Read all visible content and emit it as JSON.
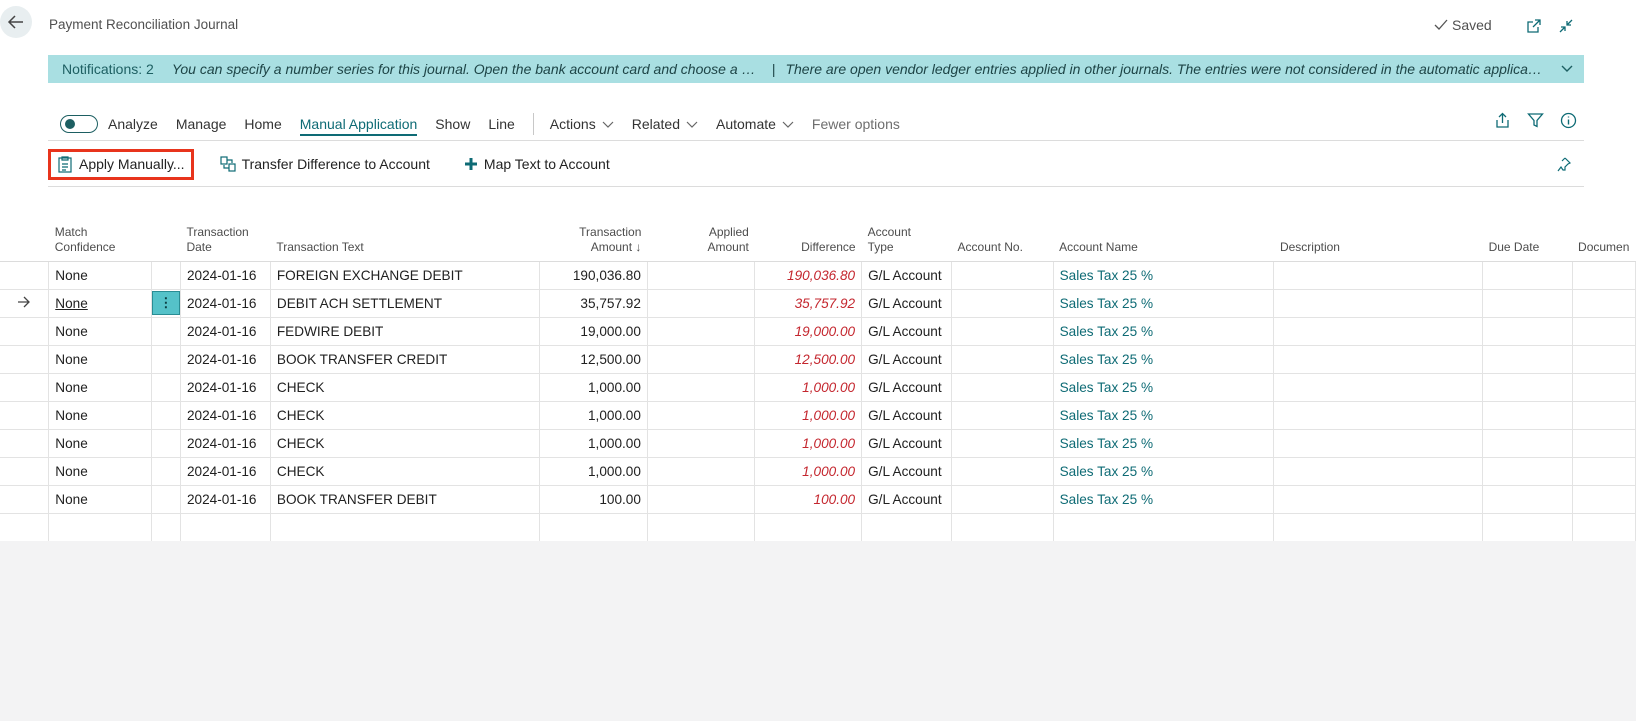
{
  "header": {
    "title": "Payment Reconciliation Journal",
    "saved": "Saved"
  },
  "notifications": {
    "count": "Notifications: 2",
    "msg1": "You can specify a number series for this journal. Open the bank account card and choose a nu...",
    "separator": "|",
    "msg2": "There are open vendor ledger entries applied in other journals. The entries were not considered in the automatic applicati..."
  },
  "menu": {
    "analyze": "Analyze",
    "manage": "Manage",
    "home": "Home",
    "manual_application": "Manual Application",
    "show": "Show",
    "line": "Line",
    "actions": "Actions",
    "related": "Related",
    "automate": "Automate",
    "fewer_options": "Fewer options"
  },
  "actions": {
    "apply_manually": "Apply Manually...",
    "transfer_difference": "Transfer Difference to Account",
    "map_text": "Map Text to Account"
  },
  "columns": {
    "match_confidence": [
      "Match",
      "Confidence"
    ],
    "transaction_date": [
      "Transaction",
      "Date"
    ],
    "transaction_text": "Transaction Text",
    "transaction_amount": [
      "Transaction",
      "Amount ↓"
    ],
    "applied_amount": [
      "Applied",
      "Amount"
    ],
    "difference": "Difference",
    "account_type": [
      "Account",
      "Type"
    ],
    "account_no": "Account No.",
    "account_name": "Account Name",
    "description": "Description",
    "due_date": "Due Date",
    "document": "Documen"
  },
  "rows": [
    {
      "match": "None",
      "date": "2024-01-16",
      "text": "FOREIGN EXCHANGE DEBIT",
      "amount": "190,036.80",
      "applied": "",
      "diff": "190,036.80",
      "type": "G/L Account",
      "no": "",
      "name": "Sales Tax 25 %"
    },
    {
      "match": "None",
      "date": "2024-01-16",
      "text": "DEBIT ACH SETTLEMENT",
      "amount": "35,757.92",
      "applied": "",
      "diff": "35,757.92",
      "type": "G/L Account",
      "no": "",
      "name": "Sales Tax 25 %"
    },
    {
      "match": "None",
      "date": "2024-01-16",
      "text": "FEDWIRE DEBIT",
      "amount": "19,000.00",
      "applied": "",
      "diff": "19,000.00",
      "type": "G/L Account",
      "no": "",
      "name": "Sales Tax 25 %"
    },
    {
      "match": "None",
      "date": "2024-01-16",
      "text": "BOOK TRANSFER CREDIT",
      "amount": "12,500.00",
      "applied": "",
      "diff": "12,500.00",
      "type": "G/L Account",
      "no": "",
      "name": "Sales Tax 25 %"
    },
    {
      "match": "None",
      "date": "2024-01-16",
      "text": "CHECK",
      "amount": "1,000.00",
      "applied": "",
      "diff": "1,000.00",
      "type": "G/L Account",
      "no": "",
      "name": "Sales Tax 25 %"
    },
    {
      "match": "None",
      "date": "2024-01-16",
      "text": "CHECK",
      "amount": "1,000.00",
      "applied": "",
      "diff": "1,000.00",
      "type": "G/L Account",
      "no": "",
      "name": "Sales Tax 25 %"
    },
    {
      "match": "None",
      "date": "2024-01-16",
      "text": "CHECK",
      "amount": "1,000.00",
      "applied": "",
      "diff": "1,000.00",
      "type": "G/L Account",
      "no": "",
      "name": "Sales Tax 25 %"
    },
    {
      "match": "None",
      "date": "2024-01-16",
      "text": "CHECK",
      "amount": "1,000.00",
      "applied": "",
      "diff": "1,000.00",
      "type": "G/L Account",
      "no": "",
      "name": "Sales Tax 25 %"
    },
    {
      "match": "None",
      "date": "2024-01-16",
      "text": "BOOK TRANSFER DEBIT",
      "amount": "100.00",
      "applied": "",
      "diff": "100.00",
      "type": "G/L Account",
      "no": "",
      "name": "Sales Tax 25 %"
    }
  ],
  "colors": {
    "accent": "#0e6b75",
    "notification_bg": "#a9dfe2",
    "difference": "#c4262e",
    "highlight_border": "#e8341c"
  }
}
